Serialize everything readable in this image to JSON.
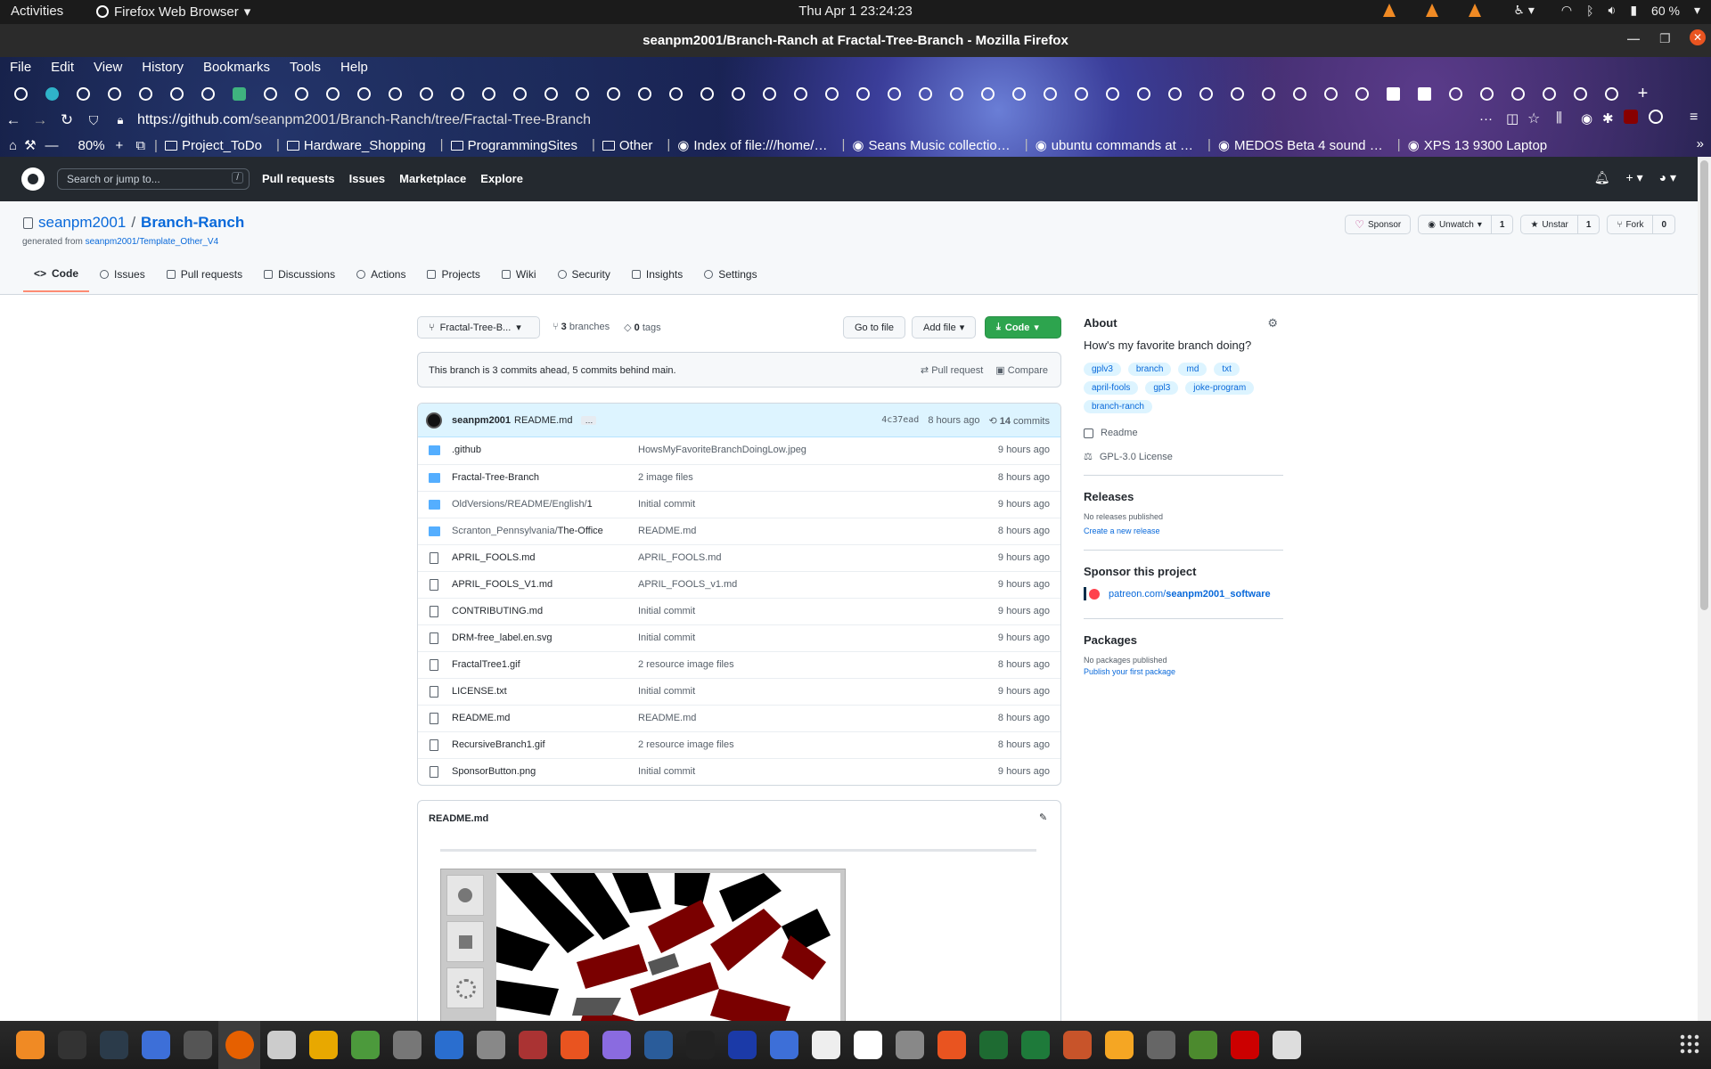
{
  "system": {
    "activities": "Activities",
    "app_menu": "Firefox Web Browser",
    "clock": "Thu Apr 1  23:24:23",
    "battery": "60 %"
  },
  "window": {
    "title": "seanpm2001/Branch-Ranch at Fractal-Tree-Branch - Mozilla Firefox"
  },
  "firefox": {
    "menu": [
      "File",
      "Edit",
      "View",
      "History",
      "Bookmarks",
      "Tools",
      "Help"
    ],
    "tab_count": 52,
    "url_host": "https://github.com",
    "url_path": "/seanpm2001/Branch-Ranch/tree/Fractal-Tree-Branch",
    "zoom": "80%",
    "bookmarks": [
      {
        "label": "Project_ToDo",
        "type": "folder"
      },
      {
        "label": "Hardware_Shopping",
        "type": "folder"
      },
      {
        "label": "ProgrammingSites",
        "type": "folder"
      },
      {
        "label": "Other",
        "type": "folder"
      },
      {
        "label": "Index of file:///home/…",
        "type": "page"
      },
      {
        "label": "Seans Music collectio…",
        "type": "page"
      },
      {
        "label": "ubuntu commands at …",
        "type": "page"
      },
      {
        "label": "MEDOS Beta 4 sound …",
        "type": "page"
      },
      {
        "label": "XPS 13 9300 Laptop",
        "type": "page"
      }
    ]
  },
  "github": {
    "search_placeholder": "Search or jump to...",
    "search_key": "/",
    "nav": [
      "Pull requests",
      "Issues",
      "Marketplace",
      "Explore"
    ],
    "owner": "seanpm2001",
    "separator": "/",
    "repo": "Branch-Ranch",
    "generated_prefix": "generated from ",
    "generated_from": "seanpm2001/Template_Other_V4",
    "sponsor": "Sponsor",
    "unwatch": "Unwatch",
    "unwatch_count": "1",
    "unstar": "Unstar",
    "star_count": "1",
    "fork": "Fork",
    "fork_count": "0",
    "tabs": [
      "Code",
      "Issues",
      "Pull requests",
      "Discussions",
      "Actions",
      "Projects",
      "Wiki",
      "Security",
      "Insights",
      "Settings"
    ],
    "branch": "Fractal-Tree-B...",
    "branches_count": "3",
    "branches_label": "branches",
    "tags_count": "0",
    "tags_label": "tags",
    "go_to_file": "Go to file",
    "add_file": "Add file",
    "code_btn": "Code",
    "ahead_msg": "This branch is 3 commits ahead, 5 commits behind main.",
    "pull_request": "Pull request",
    "compare": "Compare",
    "commit": {
      "author": "seanpm2001",
      "message": "README.md",
      "dots": "…",
      "sha": "4c37ead",
      "when": "8 hours ago",
      "count": "14",
      "count_label": "commits"
    },
    "files": [
      {
        "type": "dir",
        "prefix": "",
        "name": ".github",
        "msg": "HowsMyFavoriteBranchDoingLow.jpeg",
        "time": "9 hours ago"
      },
      {
        "type": "dir",
        "prefix": "",
        "name": "Fractal-Tree-Branch",
        "msg": "2 image files",
        "time": "8 hours ago"
      },
      {
        "type": "dir",
        "prefix": "OldVersions/README/English/",
        "name": "1",
        "msg": "Initial commit",
        "time": "9 hours ago"
      },
      {
        "type": "dir",
        "prefix": "Scranton_Pennsylvania/",
        "name": "The-Office",
        "msg": "README.md",
        "time": "8 hours ago"
      },
      {
        "type": "file",
        "prefix": "",
        "name": "APRIL_FOOLS.md",
        "msg": "APRIL_FOOLS.md",
        "time": "9 hours ago"
      },
      {
        "type": "file",
        "prefix": "",
        "name": "APRIL_FOOLS_V1.md",
        "msg": "APRIL_FOOLS_v1.md",
        "time": "9 hours ago"
      },
      {
        "type": "file",
        "prefix": "",
        "name": "CONTRIBUTING.md",
        "msg": "Initial commit",
        "time": "9 hours ago"
      },
      {
        "type": "file",
        "prefix": "",
        "name": "DRM-free_label.en.svg",
        "msg": "Initial commit",
        "time": "9 hours ago"
      },
      {
        "type": "file",
        "prefix": "",
        "name": "FractalTree1.gif",
        "msg": "2 resource image files",
        "time": "8 hours ago"
      },
      {
        "type": "file",
        "prefix": "",
        "name": "LICENSE.txt",
        "msg": "Initial commit",
        "time": "9 hours ago"
      },
      {
        "type": "file",
        "prefix": "",
        "name": "README.md",
        "msg": "README.md",
        "time": "8 hours ago"
      },
      {
        "type": "file",
        "prefix": "",
        "name": "RecursiveBranch1.gif",
        "msg": "2 resource image files",
        "time": "8 hours ago"
      },
      {
        "type": "file",
        "prefix": "",
        "name": "SponsorButton.png",
        "msg": "Initial commit",
        "time": "9 hours ago"
      }
    ],
    "readme_title": "README.md",
    "about": {
      "heading": "About",
      "description": "How's my favorite branch doing?",
      "topics": [
        "gplv3",
        "branch",
        "md",
        "txt",
        "april-fools",
        "gpl3",
        "joke-program",
        "branch-ranch"
      ],
      "readme": "Readme",
      "license": "GPL-3.0 License"
    },
    "releases": {
      "heading": "Releases",
      "none": "No releases published",
      "link": "Create a new release"
    },
    "sponsor_section": {
      "heading": "Sponsor this project",
      "link_prefix": "patreon.com/",
      "link_bold": "seanpm2001_software"
    },
    "packages": {
      "heading": "Packages",
      "none": "No packages published",
      "link": "Publish your first package"
    }
  },
  "colors": {
    "accent": "#0969da",
    "code_button": "#2da44e",
    "github_header": "#24292f",
    "patreon": "#ff424d"
  },
  "dock_apps": [
    "vlc-icon",
    "terminal-icon",
    "system-monitor-icon",
    "text-editor-icon",
    "clock-icon",
    "firefox-icon",
    "files-icon",
    "calculator-icon",
    "gedit-icon",
    "settings-icon",
    "writer-icon",
    "image-viewer-icon",
    "sound-recorder-icon",
    "software-center-icon",
    "screenshot-icon",
    "virtualbox-icon",
    "inkscape-icon",
    "audacity-icon",
    "screen-recorder-icon",
    "document-icon",
    "typora-icon",
    "mixer-icon",
    "app-store-icon",
    "gnome-shell-icon",
    "calc-icon",
    "impress-icon",
    "blender-icon",
    "gimp-icon",
    "minecraft-icon",
    "mario-icon",
    "trash-icon"
  ]
}
